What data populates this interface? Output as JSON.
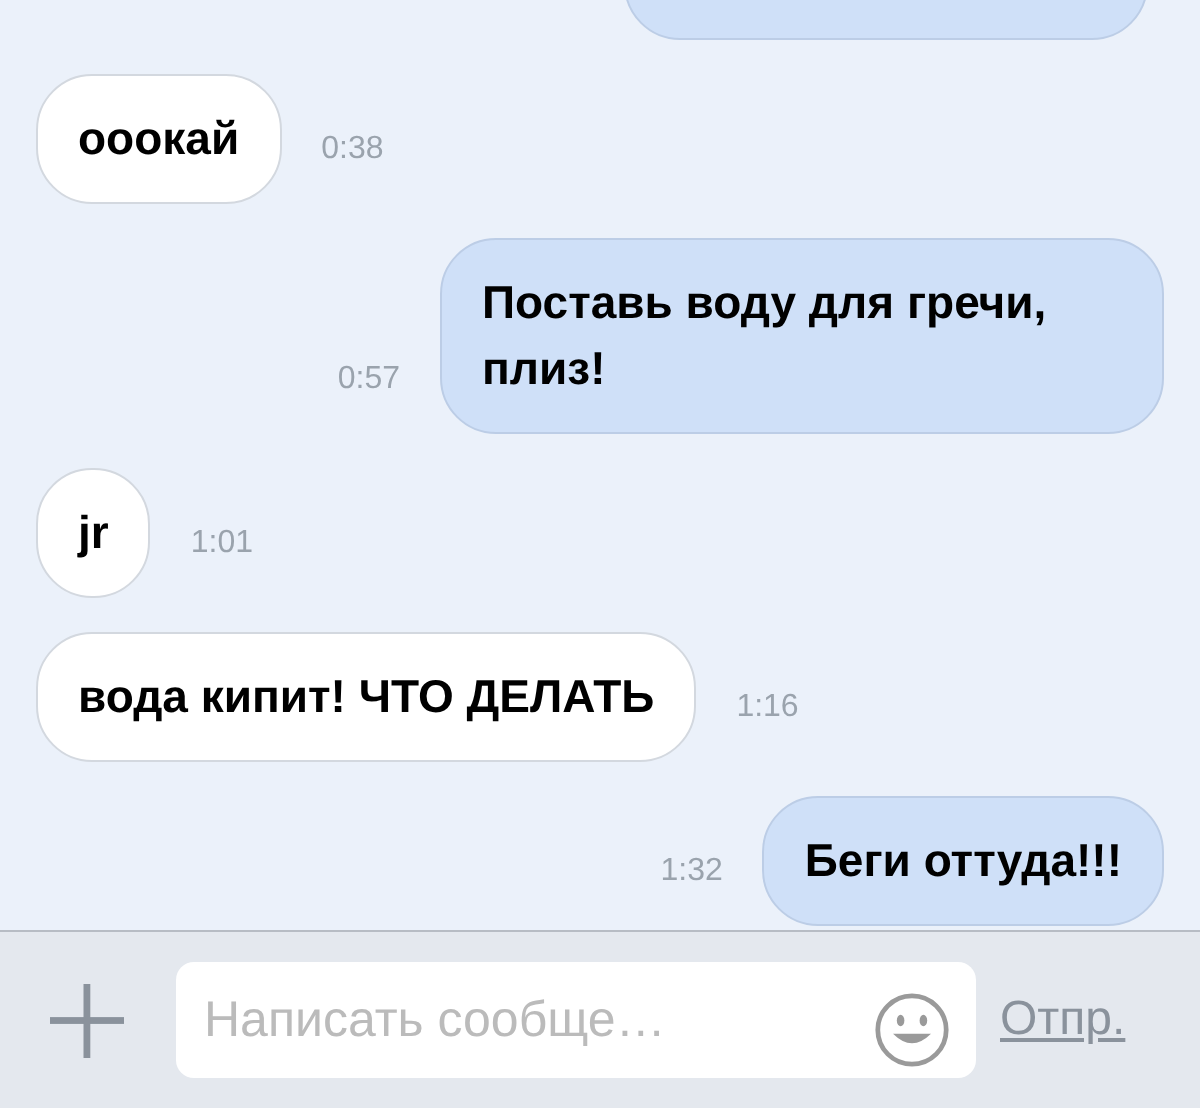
{
  "messages": [
    {
      "kind": "outgoing",
      "cut_off": true
    },
    {
      "kind": "incoming",
      "text": "ооокай",
      "time": "0:38"
    },
    {
      "kind": "outgoing",
      "text": "Поставь воду для гречи, плиз!",
      "time": "0:57"
    },
    {
      "kind": "incoming",
      "text": "jr",
      "time": "1:01"
    },
    {
      "kind": "incoming",
      "text": "вода кипит! ЧТО ДЕЛАТЬ",
      "time": "1:16"
    },
    {
      "kind": "outgoing",
      "text": "Беги оттуда!!!",
      "time": "1:32"
    }
  ],
  "composer": {
    "placeholder": "Написать сообще…",
    "send_label": "Отпр."
  }
}
